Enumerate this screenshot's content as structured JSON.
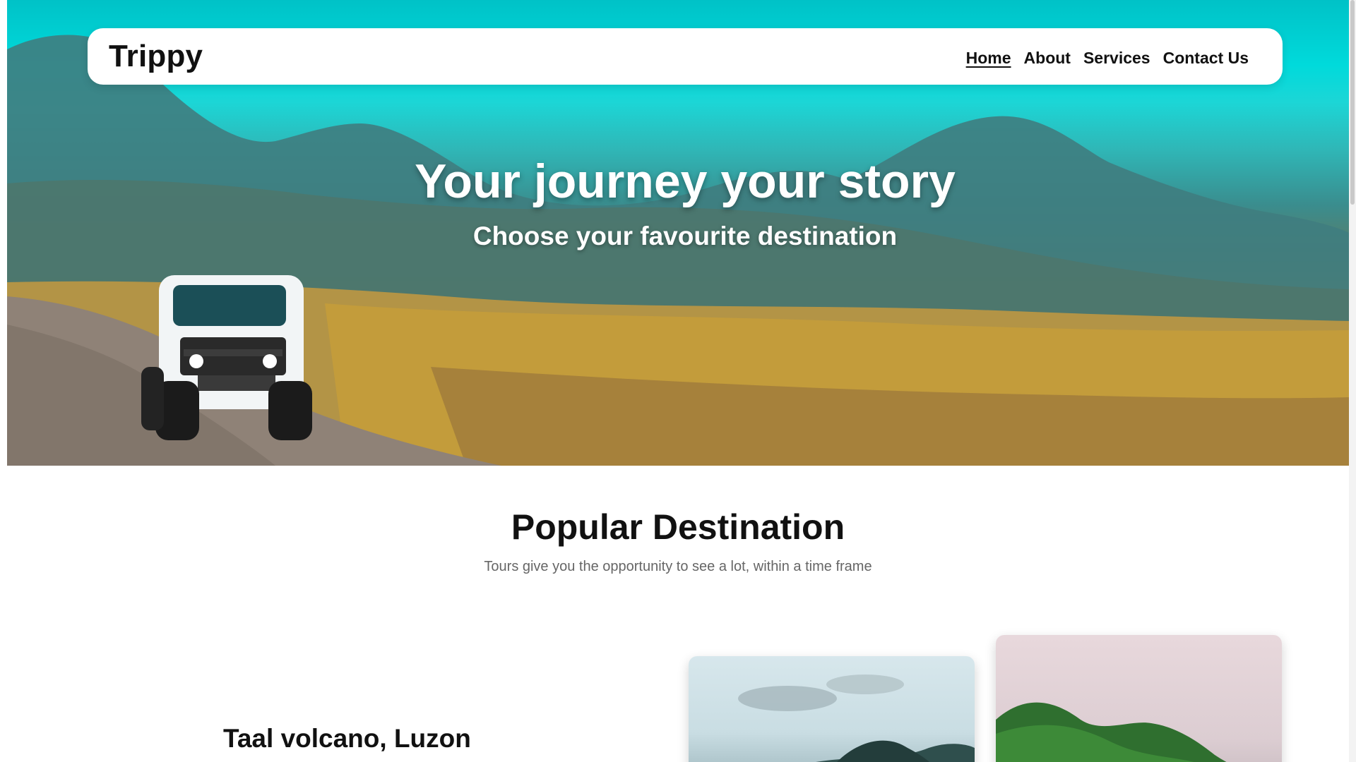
{
  "brand": "Trippy",
  "nav": {
    "items": [
      {
        "label": "Home",
        "active": true
      },
      {
        "label": "About",
        "active": false
      },
      {
        "label": "Services",
        "active": false
      },
      {
        "label": "Contact Us",
        "active": false
      }
    ]
  },
  "hero": {
    "title": "Your journey your story",
    "subtitle": "Choose your favourite destination"
  },
  "popular": {
    "title": "Popular Destination",
    "subtitle": "Tours give you the opportunity to see a lot, within a time frame",
    "destination": {
      "name": "Taal volcano, Luzon"
    }
  },
  "colors": {
    "sky": "#00dadb",
    "text": "#111111",
    "muted": "#666666"
  },
  "icons": {
    "hero_image": "jeep-in-grassland",
    "card_images": [
      "sea-islands",
      "green-mountains"
    ]
  }
}
